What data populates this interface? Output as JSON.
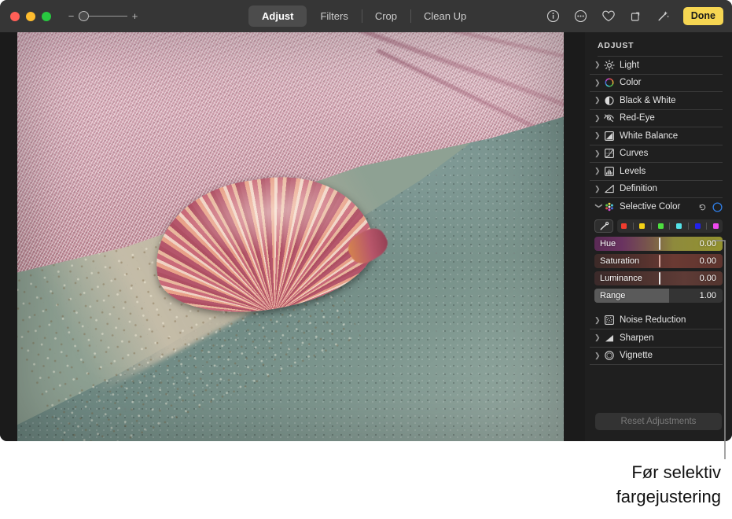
{
  "window": {
    "traffic_lights": [
      "close",
      "minimize",
      "zoom"
    ],
    "zoom_control": {
      "minus": "−",
      "plus": "+",
      "value": 0
    }
  },
  "toolbar": {
    "tabs": [
      {
        "label": "Adjust",
        "active": true
      },
      {
        "label": "Filters",
        "active": false
      },
      {
        "label": "Crop",
        "active": false
      },
      {
        "label": "Clean Up",
        "active": false
      }
    ],
    "icons": [
      "info-icon",
      "more-options-icon",
      "favorite-heart-icon",
      "rotate-icon",
      "auto-enhance-wand-icon"
    ],
    "done_label": "Done"
  },
  "sidebar": {
    "title": "ADJUST",
    "items": [
      {
        "label": "Light",
        "icon": "light-icon",
        "expanded": false
      },
      {
        "label": "Color",
        "icon": "color-wheel-icon",
        "expanded": false
      },
      {
        "label": "Black & White",
        "icon": "black-and-white-icon",
        "expanded": false
      },
      {
        "label": "Red-Eye",
        "icon": "red-eye-icon",
        "expanded": false
      },
      {
        "label": "White Balance",
        "icon": "white-balance-icon",
        "expanded": false
      },
      {
        "label": "Curves",
        "icon": "curves-icon",
        "expanded": false
      },
      {
        "label": "Levels",
        "icon": "levels-icon",
        "expanded": false
      },
      {
        "label": "Definition",
        "icon": "definition-icon",
        "expanded": false
      }
    ],
    "selective_color": {
      "label": "Selective Color",
      "icon": "selective-color-icon",
      "expanded": true,
      "reset_icon": "reset-arrow-icon",
      "toggle_icon": "on-off-circle-icon",
      "toggle_color": "#2f7fe8",
      "eyedropper_icon": "eyedropper-icon",
      "swatches": [
        {
          "name": "red",
          "color": "#f03c2e"
        },
        {
          "name": "yellow",
          "color": "#f5d316"
        },
        {
          "name": "green",
          "color": "#4ddf3e"
        },
        {
          "name": "cyan",
          "color": "#54e3e8"
        },
        {
          "name": "blue",
          "color": "#2222ec"
        },
        {
          "name": "magenta",
          "color": "#ef49ef"
        }
      ],
      "sliders": [
        {
          "label": "Hue",
          "value": "0.00",
          "knob_pct": 50,
          "gradient": "linear-gradient(90deg,#5a2a55 0%,#6a3360 22%,#7a5a4a 44%,#8e8a3c 62%,#93922f 100%)"
        },
        {
          "label": "Saturation",
          "value": "0.00",
          "knob_pct": 50,
          "gradient": "linear-gradient(90deg,#3c2a28 0%,#52312d 35%,#6b3a33 62%,#5e342e 100%)"
        },
        {
          "label": "Luminance",
          "value": "0.00",
          "knob_pct": 50,
          "gradient": "linear-gradient(90deg,#3b2a2a 0%,#4e332f 40%,#5e3b36 70%,#53352f 100%)"
        },
        {
          "label": "Range",
          "value": "1.00",
          "knob_pct": 58,
          "gradient": "none",
          "fill_pct": 58,
          "fill_color": "#5a5a5a",
          "track_color": "#343434"
        }
      ]
    },
    "bottom_items": [
      {
        "label": "Noise Reduction",
        "icon": "noise-reduction-icon",
        "expanded": false
      },
      {
        "label": "Sharpen",
        "icon": "sharpen-icon",
        "expanded": false
      },
      {
        "label": "Vignette",
        "icon": "vignette-icon",
        "expanded": false
      }
    ],
    "reset_label": "Reset Adjustments"
  },
  "photo": {
    "description": "scallop-shell-on-teal-towel-with-pink-sea-fan-coral"
  },
  "caption": {
    "line1": "Før selektiv",
    "line2": "fargejustering"
  }
}
